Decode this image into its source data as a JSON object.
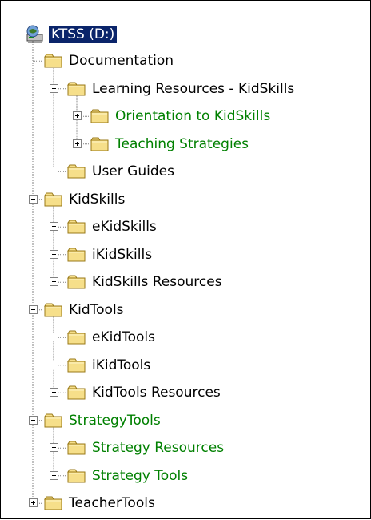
{
  "tree": {
    "root": {
      "label": "KTSS (D:)",
      "icon": "drive-icon",
      "selected": true
    },
    "items": [
      {
        "label": "Documentation",
        "level": 1,
        "state": "none",
        "color": "#000000"
      },
      {
        "label": "Learning Resources - KidSkills",
        "level": 2,
        "state": "expanded",
        "color": "#000000"
      },
      {
        "label": "Orientation to KidSkills",
        "level": 3,
        "state": "collapsed",
        "color": "#008000"
      },
      {
        "label": "Teaching Strategies",
        "level": 3,
        "state": "collapsed",
        "color": "#008000"
      },
      {
        "label": "User Guides",
        "level": 2,
        "state": "collapsed",
        "color": "#000000"
      },
      {
        "label": "KidSkills",
        "level": 1,
        "state": "expanded",
        "color": "#000000"
      },
      {
        "label": "eKidSkills",
        "level": 2,
        "state": "collapsed",
        "color": "#000000"
      },
      {
        "label": "iKidSkills",
        "level": 2,
        "state": "collapsed",
        "color": "#000000"
      },
      {
        "label": "KidSkills Resources",
        "level": 2,
        "state": "collapsed",
        "color": "#000000"
      },
      {
        "label": "KidTools",
        "level": 1,
        "state": "expanded",
        "color": "#000000"
      },
      {
        "label": "eKidTools",
        "level": 2,
        "state": "collapsed",
        "color": "#000000"
      },
      {
        "label": "iKidTools",
        "level": 2,
        "state": "collapsed",
        "color": "#000000"
      },
      {
        "label": "KidTools Resources",
        "level": 2,
        "state": "collapsed",
        "color": "#000000"
      },
      {
        "label": "StrategyTools",
        "level": 1,
        "state": "expanded",
        "color": "#008000"
      },
      {
        "label": "Strategy Resources",
        "level": 2,
        "state": "collapsed",
        "color": "#008000"
      },
      {
        "label": "Strategy Tools",
        "level": 2,
        "state": "collapsed",
        "color": "#008000"
      },
      {
        "label": "TeacherTools",
        "level": 1,
        "state": "collapsed",
        "color": "#000000"
      }
    ]
  },
  "colors": {
    "selection": "#0a246a",
    "green_text": "#008000",
    "folder_fill": "#f6df8a",
    "folder_stroke": "#9a7a18",
    "tree_lines": "#808080"
  }
}
